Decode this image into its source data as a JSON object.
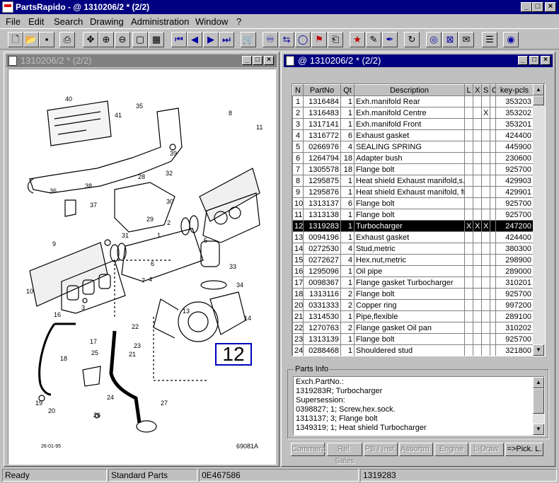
{
  "app": {
    "title": "PartsRapido - @ 1310206/2 * (2/2)"
  },
  "menu": [
    "File",
    "Edit",
    "Search",
    "Drawing",
    "Administration",
    "Window",
    "?"
  ],
  "drawing_pane": {
    "title": "1310206/2 * (2/2)",
    "callout": "12",
    "date_label": "26-01-95",
    "drawing_no": "69081A",
    "numbers": [
      "40",
      "41",
      "35",
      "8",
      "11",
      "39",
      "32",
      "28",
      "30",
      "38",
      "36",
      "37",
      "29",
      "31",
      "9",
      "2",
      "1",
      "6",
      "5",
      "4",
      "10",
      "3",
      "7",
      "33",
      "34",
      "13",
      "14",
      "22",
      "17",
      "23",
      "16",
      "18",
      "21",
      "25",
      "19",
      "24",
      "20",
      "26",
      "27"
    ]
  },
  "parts_pane": {
    "title": "@ 1310206/2 * (2/2)",
    "columns": [
      "N",
      "PartNo",
      "Qt",
      "Description",
      "L",
      "X",
      "S",
      "C",
      "key-pcls"
    ],
    "rows": [
      [
        "1",
        "1316484",
        "1",
        "Exh.manifold Rear",
        "",
        "",
        "",
        "",
        "353203"
      ],
      [
        "2",
        "1316483",
        "1",
        "Exh.manifold Centre",
        "",
        "",
        "X",
        "",
        "353202"
      ],
      [
        "3",
        "1317141",
        "1",
        "Exh.manifold Front",
        "",
        "",
        "",
        "",
        "353201"
      ],
      [
        "4",
        "1316772",
        "6",
        "Exhaust gasket",
        "",
        "",
        "",
        "",
        "424400"
      ],
      [
        "5",
        "0266976",
        "4",
        "SEALING SPRING",
        "",
        "",
        "",
        "",
        "445900"
      ],
      [
        "6",
        "1264794",
        "18",
        "Adapter bush",
        "",
        "",
        "",
        "",
        "230600"
      ],
      [
        "7",
        "1305578",
        "18",
        "Flange bolt",
        "",
        "",
        "",
        "",
        "925700"
      ],
      [
        "8",
        "1295875",
        "1",
        "Heat shield Exhaust manifold,s.",
        "",
        "",
        "",
        "",
        "429903"
      ],
      [
        "9",
        "1295876",
        "1",
        "Heat shield Exhaust manifold, fr",
        "",
        "",
        "",
        "",
        "429901"
      ],
      [
        "10",
        "1313137",
        "6",
        "Flange bolt",
        "",
        "",
        "",
        "",
        "925700"
      ],
      [
        "11",
        "1313138",
        "1",
        "Flange bolt",
        "",
        "",
        "",
        "",
        "925700"
      ],
      [
        "12",
        "1319283",
        "1",
        "Turbocharger",
        "X",
        "X",
        "X",
        "",
        "247200"
      ],
      [
        "13",
        "0094196",
        "1",
        "Exhaust gasket",
        "",
        "",
        "",
        "",
        "424400"
      ],
      [
        "14",
        "0272530",
        "4",
        "Stud,metric",
        "",
        "",
        "",
        "",
        "380300"
      ],
      [
        "15",
        "0272627",
        "4",
        "Hex.nut,metric",
        "",
        "",
        "",
        "",
        "298900"
      ],
      [
        "16",
        "1295096",
        "1",
        "Oil pipe",
        "",
        "",
        "",
        "",
        "289000"
      ],
      [
        "17",
        "0098367",
        "1",
        "Flange gasket Turbocharger",
        "",
        "",
        "",
        "",
        "310201"
      ],
      [
        "18",
        "1313116",
        "2",
        "Flange bolt",
        "",
        "",
        "",
        "",
        "925700"
      ],
      [
        "20",
        "0331333",
        "2",
        "Copper ring",
        "",
        "",
        "",
        "",
        "997200"
      ],
      [
        "21",
        "1314530",
        "1",
        "Pipe,flexible",
        "",
        "",
        "",
        "",
        "289100"
      ],
      [
        "22",
        "1270763",
        "2",
        "Flange gasket Oil pan",
        "",
        "",
        "",
        "",
        "310202"
      ],
      [
        "23",
        "1313139",
        "1",
        "Flange bolt",
        "",
        "",
        "",
        "",
        "925700"
      ],
      [
        "24",
        "0288468",
        "1",
        "Shouldered stud",
        "",
        "",
        "",
        "",
        "321800"
      ]
    ],
    "selected_row": 11
  },
  "parts_info": {
    "label": "Parts Info",
    "lines": [
      "Exch.PartNo.:",
      "1319283R; Turbocharger",
      "Supersession:",
      "0398827; 1; Screw,hex.sock.",
      "1313137; 3; Flange bolt",
      "1349319; 1; Heat shield Turbocharger"
    ]
  },
  "tabs": [
    "Commerc.",
    "Rel. Sales",
    "PB / Inst.",
    "Assortm.",
    "Engine",
    "L-Draw.",
    "=>Pick. L."
  ],
  "status": [
    "Ready",
    "Standard Parts",
    "0E467586",
    "1319283"
  ]
}
